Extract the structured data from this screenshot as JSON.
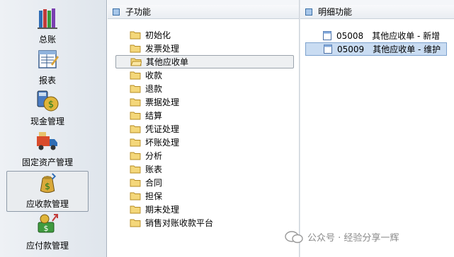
{
  "nav": {
    "items": [
      {
        "label": "总账",
        "icon": "ledger-books-icon"
      },
      {
        "label": "报表",
        "icon": "report-icon"
      },
      {
        "label": "现金管理",
        "icon": "cash-management-icon"
      },
      {
        "label": "固定资产管理",
        "icon": "fixed-assets-truck-icon"
      },
      {
        "label": "应收款管理",
        "icon": "receivables-moneybag-icon",
        "selected": true
      },
      {
        "label": "应付款管理",
        "icon": "payables-icon"
      }
    ]
  },
  "subfunctions": {
    "title": "子功能",
    "items": [
      "初始化",
      "发票处理",
      "其他应收单",
      "收款",
      "退款",
      "票据处理",
      "结算",
      "凭证处理",
      "坏账处理",
      "分析",
      "账表",
      "合同",
      "担保",
      "期末处理",
      "销售对账收款平台"
    ],
    "selected_index": 2
  },
  "details": {
    "title": "明细功能",
    "items": [
      {
        "code": "05008",
        "label": "其他应收单 - 新增"
      },
      {
        "code": "05009",
        "label": "其他应收单 - 维护",
        "selected": true
      }
    ]
  },
  "watermark": {
    "text": "公众号 · 经验分享一辉"
  },
  "colors": {
    "accent": "#3a6ea5",
    "selection": "#c9dcf2"
  }
}
